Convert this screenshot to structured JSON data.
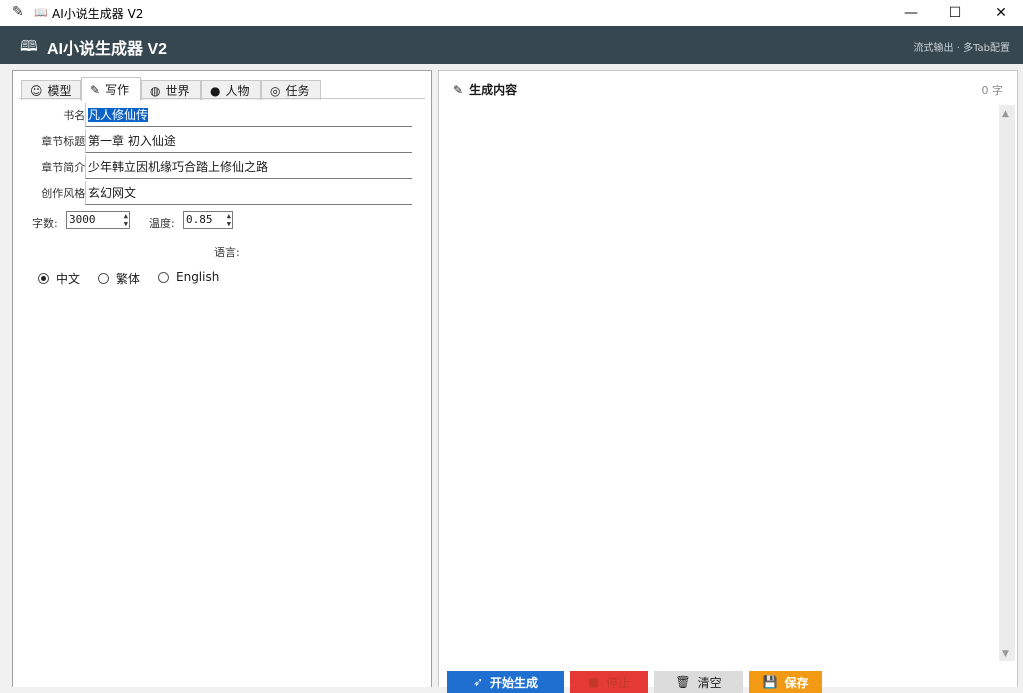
{
  "window": {
    "title": "AI小说生成器 V2"
  },
  "header": {
    "title": "AI小说生成器 V2",
    "subtitle": "流式输出 · 多Tab配置"
  },
  "tabs": [
    {
      "label": "模型",
      "icon": "robot-icon"
    },
    {
      "label": "写作",
      "icon": "edit-icon"
    },
    {
      "label": "世界",
      "icon": "globe-icon"
    },
    {
      "label": "人物",
      "icon": "person-icon"
    },
    {
      "label": "任务",
      "icon": "target-icon"
    }
  ],
  "active_tab": "写作",
  "form": {
    "book_name": {
      "label": "书名:",
      "value": "凡人修仙传"
    },
    "chapter_title": {
      "label": "章节标题:",
      "value": "第一章 初入仙途"
    },
    "chapter_summary": {
      "label": "章节简介:",
      "value": "少年韩立因机缘巧合踏上修仙之路"
    },
    "style": {
      "label": "创作风格:",
      "value": "玄幻网文"
    },
    "word_count": {
      "label": "字数:",
      "value": "3000"
    },
    "temperature": {
      "label": "温度:",
      "value": "0.85"
    },
    "language": {
      "label": "语言:",
      "options": [
        "中文",
        "繁体",
        "English"
      ],
      "selected": "中文"
    }
  },
  "output": {
    "title": "生成内容",
    "count": "0 字",
    "text": ""
  },
  "actions": {
    "start": "开始生成",
    "stop": "停止",
    "clear": "清空",
    "save": "保存"
  },
  "colors": {
    "header_bg": "#37474f",
    "start_button": "#1e6fd0",
    "stop_button": "#e53935",
    "clear_button": "#dcdcdc",
    "save_button": "#f29a13",
    "selection": "#0a63c9"
  }
}
